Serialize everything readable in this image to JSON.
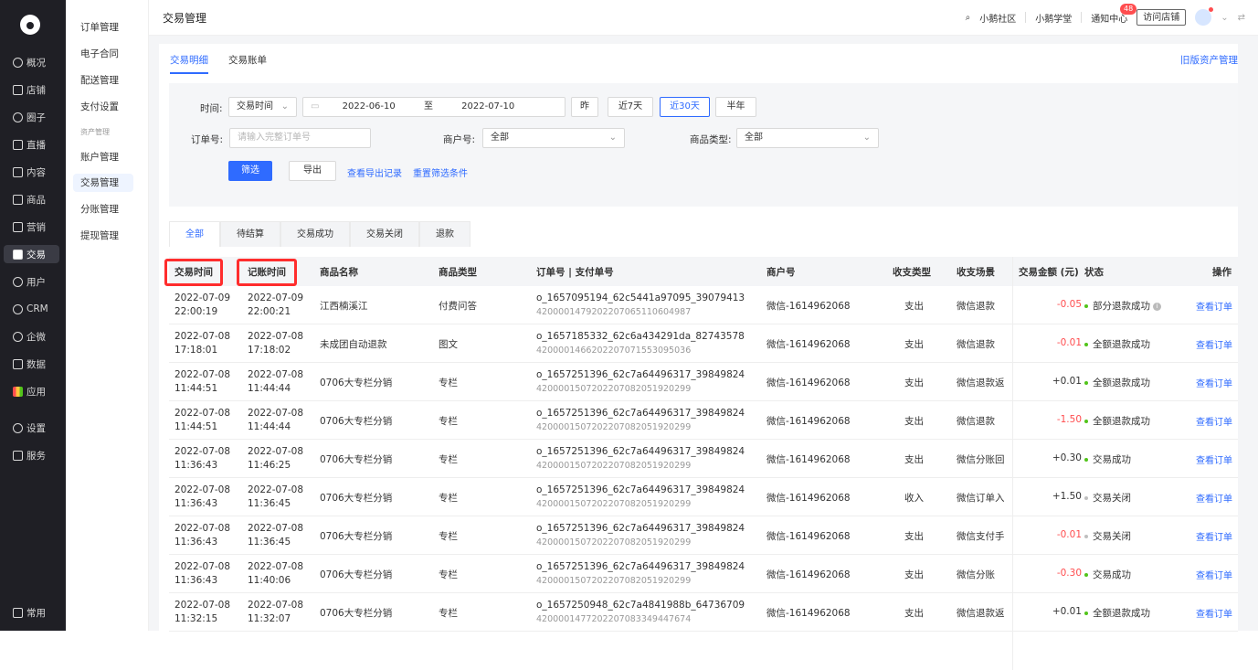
{
  "app": {
    "page_title": "交易管理"
  },
  "topbar": {
    "links": [
      "小鹅社区",
      "小鹅学堂",
      "通知中心"
    ],
    "notice_count": "48",
    "visit_store": "访问店铺"
  },
  "left_nav": {
    "items": [
      "概况",
      "店铺",
      "圈子",
      "直播",
      "内容",
      "商品",
      "营销",
      "交易",
      "用户",
      "CRM",
      "企微",
      "数据",
      "应用",
      "设置",
      "服务"
    ],
    "active": "交易",
    "bottom": "常用"
  },
  "sub_nav": {
    "items": [
      "订单管理",
      "电子合同",
      "配送管理",
      "支付设置",
      "资产管理",
      "账户管理",
      "交易管理",
      "分账管理",
      "提现管理"
    ],
    "active": "交易管理"
  },
  "tabs_top": [
    "交易明细",
    "交易账单"
  ],
  "old_link": "旧版资产管理",
  "filters": {
    "time_label": "时间:",
    "time_type": "交易时间",
    "start": "2022-06-10",
    "to": "至",
    "end": "2022-07-10",
    "quick": [
      "昨",
      "近7天",
      "近30天",
      "半年"
    ],
    "active_quick": "近30天",
    "order_label": "订单号:",
    "order_placeholder": "请输入完整订单号",
    "merchant_label": "商户号:",
    "merchant_value": "全部",
    "goods_type_label": "商品类型:",
    "goods_type_value": "全部",
    "filter_btn": "筛选",
    "export_btn": "导出",
    "export_record": "查看导出记录",
    "reset": "重置筛选条件"
  },
  "status_tabs": [
    "全部",
    "待结算",
    "交易成功",
    "交易关闭",
    "退款"
  ],
  "table": {
    "headers": [
      "交易时间",
      "记账时间",
      "商品名称",
      "商品类型",
      "订单号 | 支付单号",
      "商户号",
      "收支类型",
      "收支场景",
      "交易金额 (元)",
      "状态",
      "操作"
    ],
    "rows": [
      {
        "trade": [
          "2022-07-09",
          "22:00:19"
        ],
        "book": [
          "2022-07-09",
          "22:00:21"
        ],
        "name": "江西楠溪江",
        "type": "付费问答",
        "order": "o_1657095194_62c5441a97095_39079413",
        "pay": "4200001479202207065110604987",
        "merchant": "微信-1614962068",
        "io": "支出",
        "scene": "微信退款",
        "amount": "-0.05",
        "status": "部分退款成功",
        "status_color": "#52c41a",
        "op": "查看订单",
        "info": true
      },
      {
        "trade": [
          "2022-07-08",
          "17:18:01"
        ],
        "book": [
          "2022-07-08",
          "17:18:02"
        ],
        "name": "未成团自动退款",
        "type": "图文",
        "order": "o_1657185332_62c6a434291da_82743578",
        "pay": "4200001466202207071553095036",
        "merchant": "微信-1614962068",
        "io": "支出",
        "scene": "微信退款",
        "amount": "-0.01",
        "status": "全额退款成功",
        "status_color": "#52c41a",
        "op": "查看订单"
      },
      {
        "trade": [
          "2022-07-08",
          "11:44:51"
        ],
        "book": [
          "2022-07-08",
          "11:44:44"
        ],
        "name": "0706大专栏分销",
        "type": "专栏",
        "order": "o_1657251396_62c7a64496317_39849824",
        "pay": "4200001507202207082051920299",
        "merchant": "微信-1614962068",
        "io": "支出",
        "scene": "微信退款返",
        "amount": "+0.01",
        "status": "全额退款成功",
        "status_color": "#52c41a",
        "op": "查看订单"
      },
      {
        "trade": [
          "2022-07-08",
          "11:44:51"
        ],
        "book": [
          "2022-07-08",
          "11:44:44"
        ],
        "name": "0706大专栏分销",
        "type": "专栏",
        "order": "o_1657251396_62c7a64496317_39849824",
        "pay": "4200001507202207082051920299",
        "merchant": "微信-1614962068",
        "io": "支出",
        "scene": "微信退款",
        "amount": "-1.50",
        "status": "全额退款成功",
        "status_color": "#52c41a",
        "op": "查看订单"
      },
      {
        "trade": [
          "2022-07-08",
          "11:36:43"
        ],
        "book": [
          "2022-07-08",
          "11:46:25"
        ],
        "name": "0706大专栏分销",
        "type": "专栏",
        "order": "o_1657251396_62c7a64496317_39849824",
        "pay": "4200001507202207082051920299",
        "merchant": "微信-1614962068",
        "io": "支出",
        "scene": "微信分账回",
        "amount": "+0.30",
        "status": "交易成功",
        "status_color": "#52c41a",
        "op": "查看订单"
      },
      {
        "trade": [
          "2022-07-08",
          "11:36:43"
        ],
        "book": [
          "2022-07-08",
          "11:36:45"
        ],
        "name": "0706大专栏分销",
        "type": "专栏",
        "order": "o_1657251396_62c7a64496317_39849824",
        "pay": "4200001507202207082051920299",
        "merchant": "微信-1614962068",
        "io": "收入",
        "scene": "微信订单入",
        "amount": "+1.50",
        "status": "交易关闭",
        "status_color": "#bfbfbf",
        "op": "查看订单"
      },
      {
        "trade": [
          "2022-07-08",
          "11:36:43"
        ],
        "book": [
          "2022-07-08",
          "11:36:45"
        ],
        "name": "0706大专栏分销",
        "type": "专栏",
        "order": "o_1657251396_62c7a64496317_39849824",
        "pay": "4200001507202207082051920299",
        "merchant": "微信-1614962068",
        "io": "支出",
        "scene": "微信支付手",
        "amount": "-0.01",
        "status": "交易关闭",
        "status_color": "#bfbfbf",
        "op": "查看订单"
      },
      {
        "trade": [
          "2022-07-08",
          "11:36:43"
        ],
        "book": [
          "2022-07-08",
          "11:40:06"
        ],
        "name": "0706大专栏分销",
        "type": "专栏",
        "order": "o_1657251396_62c7a64496317_39849824",
        "pay": "4200001507202207082051920299",
        "merchant": "微信-1614962068",
        "io": "支出",
        "scene": "微信分账",
        "amount": "-0.30",
        "status": "交易成功",
        "status_color": "#52c41a",
        "op": "查看订单"
      },
      {
        "trade": [
          "2022-07-08",
          "11:32:15"
        ],
        "book": [
          "2022-07-08",
          "11:32:07"
        ],
        "name": "0706大专栏分销",
        "type": "专栏",
        "order": "o_1657250948_62c7a4841988b_64736709",
        "pay": "4200001477202207083349447674",
        "merchant": "微信-1614962068",
        "io": "支出",
        "scene": "微信退款返",
        "amount": "+0.01",
        "status": "全额退款成功",
        "status_color": "#52c41a",
        "op": "查看订单"
      }
    ]
  }
}
